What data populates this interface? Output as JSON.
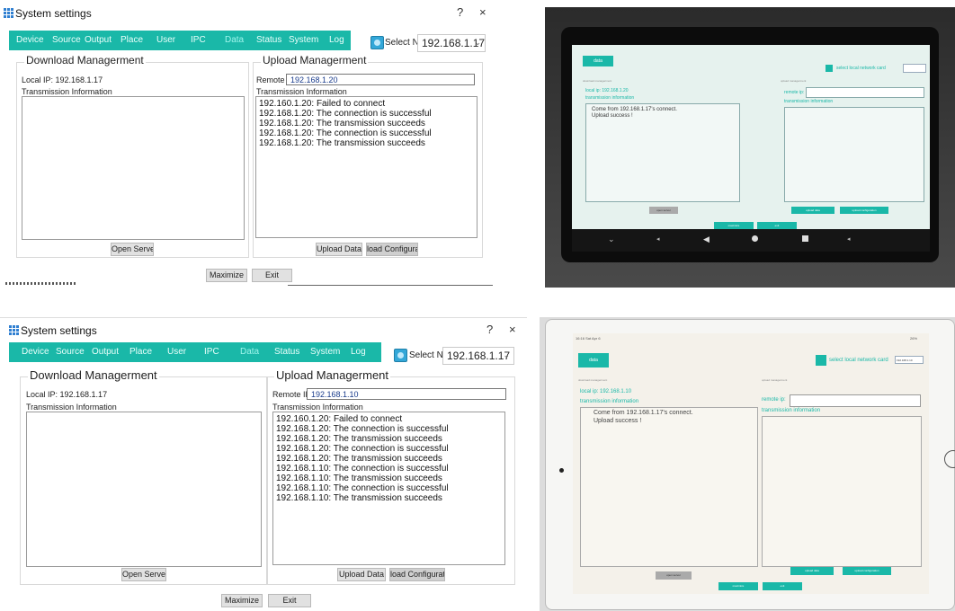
{
  "windows": [
    {
      "title": "System settings",
      "help": "?",
      "close": "×",
      "tabs": [
        "Device",
        "Source",
        "Output",
        "Place",
        "User",
        "IPC",
        "Data",
        "Status",
        "System",
        "Log"
      ],
      "nic_label": "Select NIC",
      "nic_value": "192.168.1.17",
      "download": {
        "title": "Download Managerment",
        "local_ip": "Local IP: 192.168.1.17",
        "trans_label": "Transmission Information",
        "open_server": "Open Server"
      },
      "upload": {
        "title": "Upload Managerment",
        "remote_label": "Remote IP:",
        "remote_value": "192.168.1.20",
        "trans_label": "Transmission Information",
        "log": [
          "192.160.1.20: Failed to connect",
          "192.168.1.20: The connection is successful",
          "192.168.1.20: The transmission succeeds",
          "192.168.1.20: The connection is successful",
          "192.168.1.20: The transmission succeeds"
        ],
        "upload_data": "Upload Data",
        "load_config": "load Configurati"
      },
      "maximize": "Maximize",
      "exit": "Exit"
    },
    {
      "title": "System settings",
      "help": "?",
      "close": "×",
      "tabs": [
        "Device",
        "Source",
        "Output",
        "Place",
        "User",
        "IPC",
        "Data",
        "Status",
        "System",
        "Log"
      ],
      "nic_label": "Select NIC",
      "nic_value": "192.168.1.17",
      "download": {
        "title": "Download Managerment",
        "local_ip": "Local IP: 192.168.1.17",
        "trans_label": "Transmission Information",
        "open_server": "Open Server"
      },
      "upload": {
        "title": "Upload Managerment",
        "remote_label": "Remote IP:",
        "remote_value": "192.168.1.10",
        "trans_label": "Transmission Information",
        "log": [
          "192.160.1.20: Failed to connect",
          "192.168.1.20: The connection is successful",
          "192.168.1.20: The transmission succeeds",
          "192.168.1.20: The connection is successful",
          "192.168.1.20: The transmission succeeds",
          "192.168.1.10: The connection is successful",
          "192.168.1.10: The transmission succeeds",
          "192.168.1.10: The connection is successful",
          "192.168.1.10: The transmission succeeds"
        ],
        "upload_data": "Upload Data",
        "load_config": "load Configurati"
      },
      "maximize": "Maximize",
      "exit": "Exit"
    }
  ],
  "photos": [
    {
      "tab": "data",
      "select_label": "select local network card",
      "left_group": "download managerment",
      "local_ip": "local ip: 192.168.1.20",
      "trans_label": "transmission information",
      "messages": [
        "Come from 192.168.1.17's connect.",
        "Upload success !"
      ],
      "right_group": "upload managerment",
      "remote_label": "remote ip:",
      "right_trans": "transmission information",
      "open_server": "open server",
      "upload_data": "upload data",
      "upload_config": "upload configuration",
      "maximize": "maximize",
      "exit": "exit"
    },
    {
      "status_time": "16:16  Sat Apr 6",
      "battery": "26%",
      "tab": "data",
      "select_label": "select local network card",
      "nic_value": "192.168.1.10",
      "left_group": "download managerment",
      "local_ip": "local ip: 192.168.1.10",
      "trans_label": "transmission information",
      "messages": [
        "Come from 192.168.1.17's connect.",
        "Upload success !"
      ],
      "right_group": "upload managerment",
      "remote_label": "remote ip:",
      "right_trans": "transmission information",
      "open_server": "open server",
      "upload_data": "upload data",
      "upload_config": "upload configuration",
      "maximize": "maximize",
      "exit": "exit"
    }
  ],
  "colors": {
    "teal": "#1ab8a8",
    "photo_screen": "#e6f2ee",
    "tablet_frame": "#111111"
  },
  "icons": [
    "app-grid-icon",
    "nic-icon",
    "chevron-down-icon",
    "back-icon",
    "home-icon",
    "recent-icon"
  ]
}
